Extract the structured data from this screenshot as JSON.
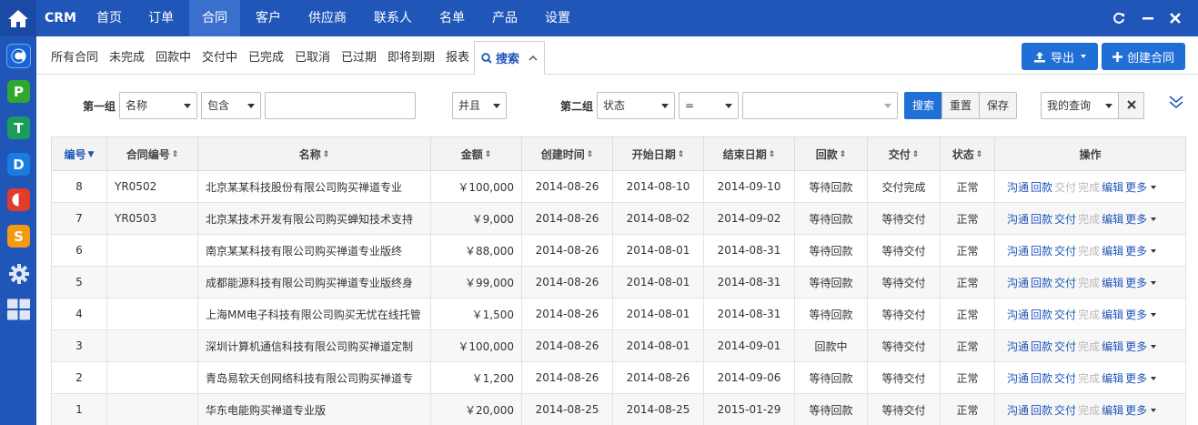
{
  "nav": {
    "brand": "CRM",
    "items": [
      {
        "label": "首页",
        "active": false
      },
      {
        "label": "订单",
        "active": false
      },
      {
        "label": "合同",
        "active": true
      },
      {
        "label": "客户",
        "active": false
      },
      {
        "label": "供应商",
        "active": false
      },
      {
        "label": "联系人",
        "active": false
      },
      {
        "label": "名单",
        "active": false
      },
      {
        "label": "产品",
        "active": false
      },
      {
        "label": "设置",
        "active": false
      }
    ]
  },
  "sidebar": {
    "apps": [
      {
        "letter": "C",
        "color": "#1565d8",
        "active": true
      },
      {
        "letter": "P",
        "color": "#2ea82e"
      },
      {
        "letter": "T",
        "color": "#1c9c5a"
      },
      {
        "letter": "D",
        "color": "#1a7be0"
      },
      {
        "letter": "",
        "color": "#e03b2b"
      },
      {
        "letter": "S",
        "color": "#f29a10"
      }
    ]
  },
  "subnav": {
    "items": [
      "所有合同",
      "未完成",
      "回款中",
      "交付中",
      "已完成",
      "已取消",
      "已过期",
      "即将到期",
      "报表"
    ],
    "search_tab": "搜索"
  },
  "actions": {
    "export": "导出",
    "create": "创建合同"
  },
  "search": {
    "group1_label": "第一组",
    "group1_field": "名称",
    "group1_op": "包含",
    "group1_value": "",
    "andor": "并且",
    "group2_label": "第二组",
    "group2_field": "状态",
    "group2_op": "=",
    "group2_value": "",
    "search_btn": "搜索",
    "reset_btn": "重置",
    "save_btn": "保存",
    "my_query": "我的查询"
  },
  "table": {
    "headers": [
      "编号",
      "合同编号",
      "名称",
      "金额",
      "创建时间",
      "开始日期",
      "结束日期",
      "回款",
      "交付",
      "状态",
      "操作"
    ],
    "actions": [
      "沟通",
      "回款",
      "交付",
      "完成",
      "编辑",
      "更多"
    ],
    "rows": [
      {
        "id": "8",
        "code": "YR0502",
        "name": "北京某某科技股份有限公司购买禅道专业",
        "amount": "￥100,000",
        "created": "2014-08-26",
        "start": "2014-08-10",
        "end": "2014-09-10",
        "payment": "等待回款",
        "delivery": "交付完成",
        "status": "正常"
      },
      {
        "id": "7",
        "code": "YR0503",
        "name": "北京某技术开发有限公司购买蝉知技术支持",
        "amount": "￥9,000",
        "created": "2014-08-26",
        "start": "2014-08-02",
        "end": "2014-09-02",
        "payment": "等待回款",
        "delivery": "等待交付",
        "status": "正常"
      },
      {
        "id": "6",
        "code": "",
        "name": "南京某某科技有限公司购买禅道专业版终",
        "amount": "￥88,000",
        "created": "2014-08-26",
        "start": "2014-08-01",
        "end": "2014-08-31",
        "payment": "等待回款",
        "delivery": "等待交付",
        "status": "正常"
      },
      {
        "id": "5",
        "code": "",
        "name": "成都能源科技有限公司购买禅道专业版终身",
        "amount": "￥99,000",
        "created": "2014-08-26",
        "start": "2014-08-01",
        "end": "2014-08-31",
        "payment": "等待回款",
        "delivery": "等待交付",
        "status": "正常"
      },
      {
        "id": "4",
        "code": "",
        "name": "上海MM电子科技有限公司购买无忧在线托管",
        "amount": "￥1,500",
        "created": "2014-08-26",
        "start": "2014-08-01",
        "end": "2014-08-31",
        "payment": "等待回款",
        "delivery": "等待交付",
        "status": "正常"
      },
      {
        "id": "3",
        "code": "",
        "name": "深圳计算机通信科技有限公司购买禅道定制",
        "amount": "￥100,000",
        "created": "2014-08-26",
        "start": "2014-08-01",
        "end": "2014-09-01",
        "payment": "回款中",
        "delivery": "等待交付",
        "status": "正常"
      },
      {
        "id": "2",
        "code": "",
        "name": "青岛易软天创网络科技有限公司购买禅道专",
        "amount": "￥1,200",
        "created": "2014-08-26",
        "start": "2014-08-26",
        "end": "2014-09-06",
        "payment": "等待回款",
        "delivery": "等待交付",
        "status": "正常"
      },
      {
        "id": "1",
        "code": "",
        "name": "华东电能购买禅道专业版",
        "amount": "￥20,000",
        "created": "2014-08-25",
        "start": "2014-08-25",
        "end": "2015-01-29",
        "payment": "等待回款",
        "delivery": "等待交付",
        "status": "正常"
      }
    ]
  }
}
